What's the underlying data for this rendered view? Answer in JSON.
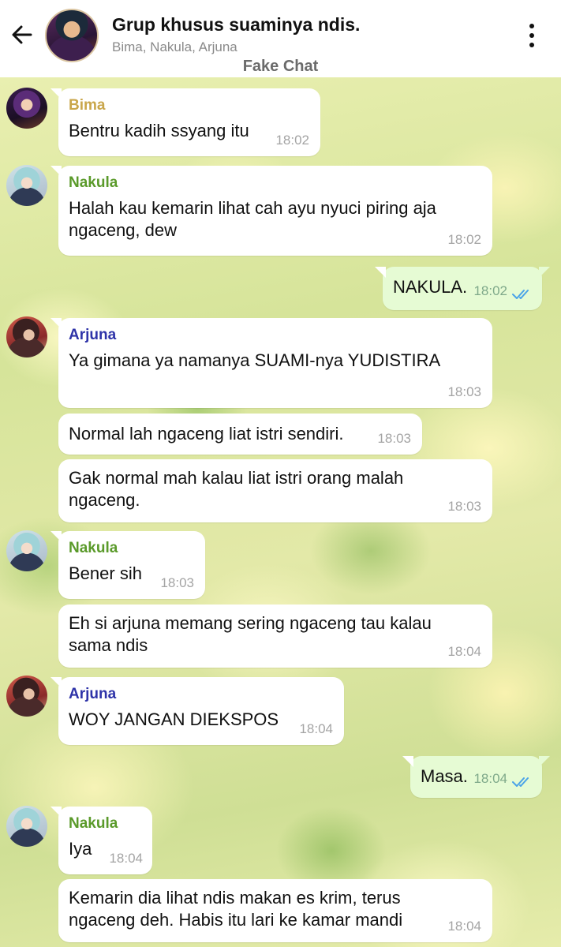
{
  "header": {
    "title": "Grup khusus suaminya ndis.",
    "members": "Bima, Nakula, Arjuna",
    "watermark": "Fake Chat"
  },
  "colors": {
    "bima": "#c9a64b",
    "nakula": "#5a9a2a",
    "arjuna": "#2e33a8",
    "ticks": "#4aa3e8"
  },
  "icons": {
    "back": "arrow-left-icon",
    "menu": "more-vertical-icon"
  },
  "messages": [
    {
      "sender": "Bima",
      "text": "Bentru kadih ssyang itu",
      "time": "18:02"
    },
    {
      "sender": "Nakula",
      "text": "Halah kau kemarin lihat cah ayu nyuci piring aja ngaceng, dew",
      "time": "18:02"
    },
    {
      "sender": "",
      "text": "NAKULA.",
      "time": "18:02"
    },
    {
      "sender": "Arjuna",
      "text": "Ya gimana ya namanya SUAMI-nya YUDISTIRA",
      "time": "18:03"
    },
    {
      "sender": "",
      "text": "Normal lah ngaceng liat istri sendiri.",
      "time": "18:03"
    },
    {
      "sender": "",
      "text": "Gak normal mah kalau liat istri orang malah ngaceng.",
      "time": "18:03"
    },
    {
      "sender": "Nakula",
      "text": "Bener sih",
      "time": "18:03"
    },
    {
      "sender": "",
      "text": "Eh si arjuna memang sering ngaceng tau kalau sama ndis",
      "time": "18:04"
    },
    {
      "sender": "Arjuna",
      "text": "WOY JANGAN DIEKSPOS",
      "time": "18:04"
    },
    {
      "sender": "",
      "text": "Masa.",
      "time": "18:04"
    },
    {
      "sender": "Nakula",
      "text": "Iya",
      "time": "18:04"
    },
    {
      "sender": "",
      "text": "Kemarin dia lihat ndis makan es krim, terus ngaceng deh. Habis itu lari ke kamar mandi",
      "time": "18:04"
    }
  ]
}
